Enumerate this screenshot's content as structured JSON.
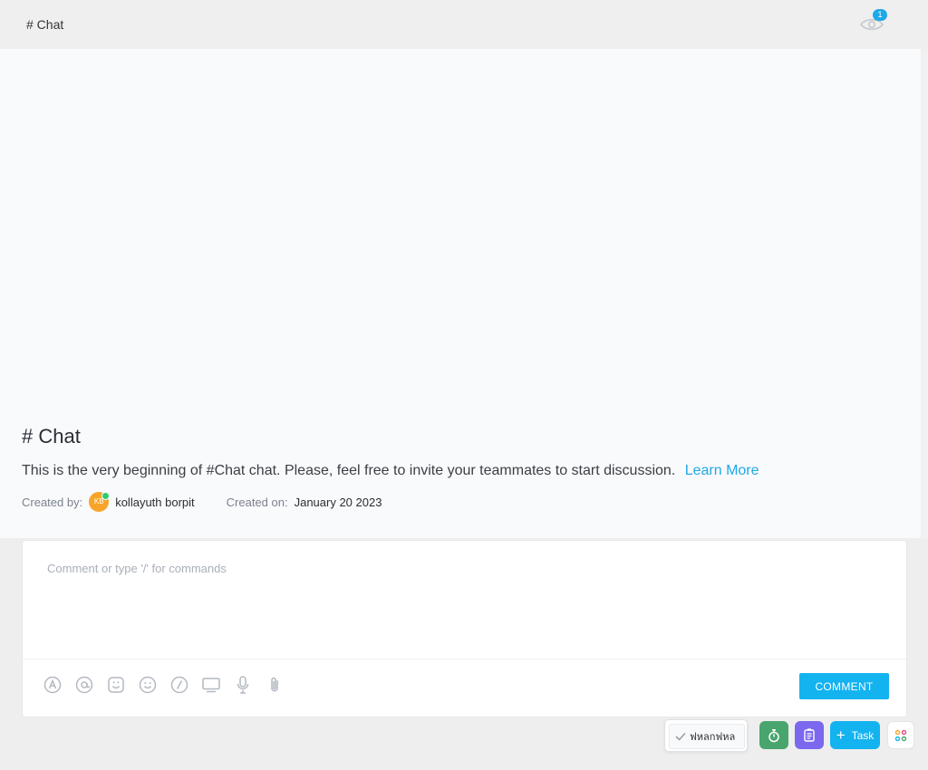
{
  "header": {
    "title": "# Chat",
    "watchers_count": "1"
  },
  "channel": {
    "title": "# Chat",
    "intro": "This is the very beginning of #Chat chat. Please, feel free to invite your teammates to start discussion.",
    "learn_more": "Learn More",
    "created_by_label": "Created by:",
    "creator_initials": "KB",
    "creator_name": "kollayuth borpit",
    "created_on_label": "Created on:",
    "created_on": "January 20 2023"
  },
  "composer": {
    "placeholder": "Comment or type '/' for commands",
    "submit_label": "COMMENT",
    "tools": [
      "assign-icon",
      "mention-icon",
      "emoji-reaction-icon",
      "smiley-icon",
      "slash-command-icon",
      "screen-record-icon",
      "microphone-icon",
      "attachment-icon"
    ]
  },
  "tray": {
    "item_label": "ฟหลกฟหล"
  },
  "fabs": {
    "task_label": "Task"
  },
  "colors": {
    "accent": "#13b3f0",
    "timer": "#49a56e",
    "notes": "#7b68ee",
    "avatar": "#f7a52a",
    "online": "#2ecc71"
  }
}
